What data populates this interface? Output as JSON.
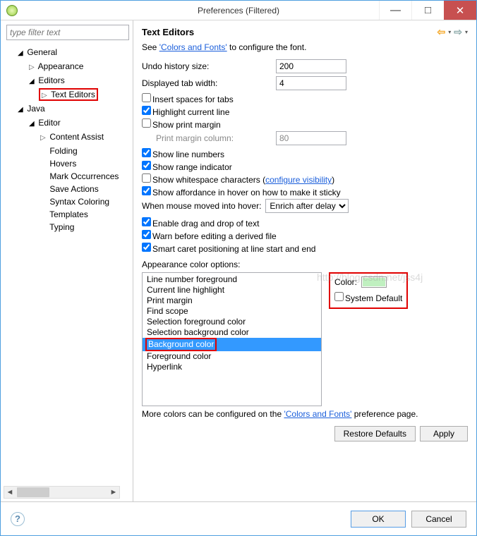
{
  "window": {
    "title": "Preferences (Filtered)"
  },
  "sidebar": {
    "filter_placeholder": "type filter text",
    "tree": {
      "general": "General",
      "appearance": "Appearance",
      "editors": "Editors",
      "text_editors": "Text Editors",
      "java": "Java",
      "editor": "Editor",
      "content_assist": "Content Assist",
      "folding": "Folding",
      "hovers": "Hovers",
      "mark_occurrences": "Mark Occurrences",
      "save_actions": "Save Actions",
      "syntax_coloring": "Syntax Coloring",
      "templates": "Templates",
      "typing": "Typing"
    }
  },
  "main": {
    "title": "Text Editors",
    "see_prefix": "See ",
    "see_link": "'Colors and Fonts'",
    "see_suffix": " to configure the font.",
    "undo_label": "Undo history size:",
    "undo_value": "200",
    "tabwidth_label": "Displayed tab width:",
    "tabwidth_value": "4",
    "insert_spaces": "Insert spaces for tabs",
    "highlight_line": "Highlight current line",
    "show_print_margin": "Show print margin",
    "print_margin_col_label": "Print margin column:",
    "print_margin_col_value": "80",
    "show_line_numbers": "Show line numbers",
    "show_range_indicator": "Show range indicator",
    "show_whitespace": "Show whitespace characters (",
    "configure_visibility": "configure visibility",
    "show_whitespace_close": ")",
    "show_affordance": "Show affordance in hover on how to make it sticky",
    "mouse_hover_label": "When mouse moved into hover:",
    "mouse_hover_selected": "Enrich after delay",
    "enable_dnd": "Enable drag and drop of text",
    "warn_derived": "Warn before editing a derived file",
    "smart_caret": "Smart caret positioning at line start and end",
    "appearance_label": "Appearance color options:",
    "color_label": "Color:",
    "system_default": "System Default",
    "appearance_items": [
      "Line number foreground",
      "Current line highlight",
      "Print margin",
      "Find scope",
      "Selection foreground color",
      "Selection background color",
      "Background color",
      "Foreground color",
      "Hyperlink"
    ],
    "selected_item_index": 6,
    "swatch_color": "#c0f0c0",
    "more_prefix": "More colors can be configured on the ",
    "more_link": "'Colors and Fonts'",
    "more_suffix": " preference page.",
    "restore_defaults": "Restore Defaults",
    "apply": "Apply"
  },
  "footer": {
    "ok": "OK",
    "cancel": "Cancel"
  },
  "watermark": "http://blog.csdn.net/jss4j"
}
